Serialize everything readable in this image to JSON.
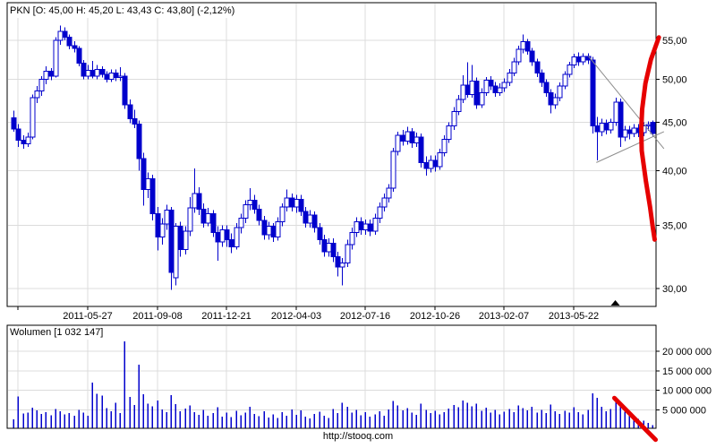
{
  "header": {
    "title": "PKN [O: 45,00 H: 45,20 L: 43,43 C: 43,80] (-2,12%)"
  },
  "footer": {
    "watermark": "http://stooq.com"
  },
  "colors": {
    "candle": "#0000cc",
    "grid": "#dcdcdc",
    "frame": "#000000",
    "trend_line": "#8c8c8c",
    "signal": "#e60000",
    "text": "#000000",
    "background": "#ffffff"
  },
  "chart_data": [
    {
      "panel": "price",
      "type": "candlestick",
      "symbol": "PKN",
      "last_candle": {
        "open": "45,00",
        "high": "45,20",
        "low": "43,43",
        "close": "43,80",
        "change_pct": "-2,12%"
      },
      "scale": "log",
      "grid": true,
      "ylim": [
        28.7,
        60.3
      ],
      "y_ticks": [
        {
          "value": 30,
          "label": "30,00"
        },
        {
          "value": 35,
          "label": "35,00"
        },
        {
          "value": 40,
          "label": "40,00"
        },
        {
          "value": 45,
          "label": "45,00"
        },
        {
          "value": 50,
          "label": "50,00"
        },
        {
          "value": 55,
          "label": "55,00"
        }
      ],
      "x_ticks": [
        {
          "index": 1,
          "label": ""
        },
        {
          "index": 16,
          "label": "2011-05-27"
        },
        {
          "index": 31,
          "label": "2011-09-08"
        },
        {
          "index": 46,
          "label": "2011-12-21"
        },
        {
          "index": 61,
          "label": "2012-04-03"
        },
        {
          "index": 76,
          "label": "2012-07-16"
        },
        {
          "index": 91,
          "label": "2012-10-26"
        },
        {
          "index": 106,
          "label": "2013-02-07"
        },
        {
          "index": 121,
          "label": "2013-05-22"
        }
      ],
      "candles_ohlc": [
        [
          45.5,
          46.3,
          44.0,
          44.3
        ],
        [
          44.3,
          44.8,
          42.4,
          43.1
        ],
        [
          43.1,
          43.6,
          42.2,
          42.7
        ],
        [
          42.7,
          43.9,
          42.4,
          43.4
        ],
        [
          43.4,
          48.2,
          43.2,
          47.8
        ],
        [
          47.8,
          49.2,
          47.2,
          48.6
        ],
        [
          48.6,
          50.4,
          48.0,
          50.0
        ],
        [
          50.0,
          51.6,
          49.4,
          51.0
        ],
        [
          51.0,
          51.4,
          49.9,
          50.4
        ],
        [
          50.4,
          55.4,
          50.2,
          55.0
        ],
        [
          55.0,
          57.0,
          54.4,
          56.2
        ],
        [
          56.2,
          56.8,
          55.0,
          55.4
        ],
        [
          55.4,
          55.8,
          53.8,
          54.3
        ],
        [
          54.3,
          54.9,
          53.4,
          53.9
        ],
        [
          53.9,
          54.2,
          51.6,
          52.0
        ],
        [
          52.0,
          52.4,
          50.0,
          50.4
        ],
        [
          50.4,
          51.8,
          50.0,
          51.1
        ],
        [
          51.1,
          52.3,
          50.1,
          50.4
        ],
        [
          50.4,
          51.8,
          50.0,
          51.2
        ],
        [
          51.2,
          51.6,
          50.2,
          50.6
        ],
        [
          50.6,
          51.0,
          49.6,
          50.0
        ],
        [
          50.0,
          51.2,
          49.7,
          50.8
        ],
        [
          50.8,
          51.2,
          49.8,
          50.2
        ],
        [
          50.2,
          51.5,
          49.8,
          50.4
        ],
        [
          50.4,
          50.8,
          46.5,
          47.0
        ],
        [
          47.0,
          47.6,
          44.9,
          45.4
        ],
        [
          45.4,
          46.4,
          44.4,
          44.8
        ],
        [
          44.8,
          45.2,
          40.0,
          41.2
        ],
        [
          41.2,
          41.8,
          36.7,
          38.2
        ],
        [
          38.2,
          39.8,
          37.4,
          39.2
        ],
        [
          39.2,
          39.6,
          35.4,
          36.0
        ],
        [
          36.0,
          36.6,
          32.9,
          34.0
        ],
        [
          34.0,
          35.6,
          33.4,
          35.1
        ],
        [
          35.1,
          36.8,
          34.6,
          36.3
        ],
        [
          36.3,
          36.6,
          29.9,
          31.2
        ],
        [
          30.8,
          35.2,
          30.2,
          34.9
        ],
        [
          34.9,
          35.3,
          32.4,
          33.0
        ],
        [
          33.0,
          34.9,
          32.6,
          34.5
        ],
        [
          34.5,
          37.5,
          34.1,
          36.5
        ],
        [
          36.5,
          40.2,
          36.1,
          37.8
        ],
        [
          37.8,
          38.4,
          35.9,
          36.4
        ],
        [
          36.4,
          36.9,
          34.8,
          35.2
        ],
        [
          35.2,
          36.5,
          34.9,
          36.0
        ],
        [
          36.0,
          36.3,
          34.0,
          34.4
        ],
        [
          34.4,
          34.9,
          32.1,
          33.6
        ],
        [
          33.6,
          35.0,
          33.2,
          34.6
        ],
        [
          34.6,
          35.0,
          33.2,
          33.8
        ],
        [
          33.8,
          34.3,
          32.7,
          33.2
        ],
        [
          33.2,
          35.2,
          33.0,
          34.8
        ],
        [
          34.8,
          36.0,
          34.3,
          35.6
        ],
        [
          35.6,
          37.2,
          35.2,
          36.8
        ],
        [
          36.8,
          38.3,
          36.3,
          37.2
        ],
        [
          37.2,
          37.7,
          36.0,
          36.4
        ],
        [
          36.4,
          36.8,
          35.0,
          35.4
        ],
        [
          35.4,
          35.8,
          33.8,
          34.2
        ],
        [
          34.2,
          35.3,
          33.8,
          34.9
        ],
        [
          34.9,
          35.2,
          33.6,
          34.0
        ],
        [
          34.0,
          35.7,
          33.7,
          35.3
        ],
        [
          35.3,
          36.9,
          34.9,
          36.6
        ],
        [
          36.6,
          38.2,
          36.2,
          37.4
        ],
        [
          37.4,
          37.8,
          36.2,
          36.6
        ],
        [
          36.6,
          37.7,
          36.1,
          37.3
        ],
        [
          37.3,
          37.7,
          35.8,
          36.2
        ],
        [
          36.2,
          36.6,
          34.8,
          35.2
        ],
        [
          35.2,
          36.3,
          34.8,
          35.9
        ],
        [
          35.9,
          36.2,
          34.4,
          34.8
        ],
        [
          34.8,
          35.2,
          33.4,
          33.8
        ],
        [
          33.8,
          34.2,
          32.4,
          32.8
        ],
        [
          32.8,
          33.9,
          32.4,
          33.5
        ],
        [
          33.5,
          33.9,
          32.0,
          32.4
        ],
        [
          32.4,
          32.8,
          30.9,
          31.6
        ],
        [
          31.6,
          32.3,
          30.2,
          31.9
        ],
        [
          31.9,
          33.8,
          31.6,
          33.4
        ],
        [
          33.4,
          34.8,
          33.0,
          34.4
        ],
        [
          34.4,
          35.7,
          34.0,
          35.3
        ],
        [
          35.3,
          35.7,
          34.2,
          34.6
        ],
        [
          34.6,
          35.5,
          34.2,
          35.1
        ],
        [
          35.1,
          35.5,
          34.1,
          34.5
        ],
        [
          34.5,
          36.0,
          34.2,
          35.6
        ],
        [
          35.6,
          37.0,
          35.2,
          36.6
        ],
        [
          36.6,
          37.8,
          36.2,
          37.4
        ],
        [
          37.4,
          38.7,
          37.0,
          38.3
        ],
        [
          38.3,
          42.3,
          38.0,
          41.9
        ],
        [
          41.9,
          44.0,
          41.5,
          43.6
        ],
        [
          43.6,
          44.2,
          42.5,
          43.0
        ],
        [
          43.0,
          44.5,
          42.6,
          44.0
        ],
        [
          44.0,
          44.4,
          42.3,
          42.8
        ],
        [
          42.8,
          43.9,
          42.4,
          43.4
        ],
        [
          43.4,
          43.8,
          40.3,
          40.8
        ],
        [
          40.8,
          41.4,
          39.5,
          40.2
        ],
        [
          40.2,
          41.5,
          39.8,
          41.0
        ],
        [
          41.0,
          41.5,
          39.9,
          40.4
        ],
        [
          40.4,
          42.2,
          40.1,
          41.8
        ],
        [
          41.8,
          43.6,
          41.4,
          43.2
        ],
        [
          43.2,
          45.0,
          42.8,
          44.6
        ],
        [
          44.6,
          46.7,
          44.2,
          46.2
        ],
        [
          46.2,
          48.1,
          45.8,
          47.6
        ],
        [
          47.6,
          50.5,
          47.2,
          49.3
        ],
        [
          49.3,
          52.1,
          47.8,
          48.2
        ],
        [
          48.2,
          51.8,
          47.8,
          49.8
        ],
        [
          49.8,
          50.2,
          46.5,
          47.0
        ],
        [
          47.0,
          48.9,
          46.6,
          48.4
        ],
        [
          48.4,
          50.3,
          48.0,
          49.9
        ],
        [
          49.9,
          50.4,
          48.7,
          49.2
        ],
        [
          49.2,
          49.7,
          47.9,
          48.4
        ],
        [
          48.4,
          49.5,
          48.0,
          49.0
        ],
        [
          49.0,
          50.1,
          48.5,
          49.6
        ],
        [
          49.6,
          51.3,
          49.2,
          50.8
        ],
        [
          50.8,
          52.7,
          50.4,
          52.2
        ],
        [
          52.2,
          54.3,
          51.8,
          53.8
        ],
        [
          53.8,
          55.8,
          53.3,
          54.8
        ],
        [
          54.8,
          55.2,
          53.1,
          53.6
        ],
        [
          53.6,
          54.0,
          51.7,
          52.2
        ],
        [
          52.2,
          52.6,
          50.3,
          50.8
        ],
        [
          50.8,
          51.2,
          49.1,
          49.6
        ],
        [
          49.6,
          50.0,
          47.9,
          48.4
        ],
        [
          48.4,
          48.8,
          46.0,
          47.0
        ],
        [
          47.0,
          48.3,
          46.5,
          47.8
        ],
        [
          47.8,
          49.6,
          47.4,
          49.2
        ],
        [
          49.2,
          51.0,
          48.8,
          50.6
        ],
        [
          50.6,
          52.2,
          50.2,
          51.8
        ],
        [
          51.8,
          53.2,
          51.4,
          52.8
        ],
        [
          52.8,
          53.4,
          51.7,
          52.2
        ],
        [
          52.2,
          53.3,
          51.8,
          52.9
        ],
        [
          52.9,
          53.3,
          51.9,
          52.4
        ],
        [
          52.4,
          52.8,
          43.8,
          44.6
        ],
        [
          44.6,
          45.6,
          41.0,
          44.0
        ],
        [
          44.0,
          45.4,
          43.5,
          44.9
        ],
        [
          44.9,
          45.3,
          43.7,
          44.2
        ],
        [
          44.2,
          45.4,
          43.8,
          45.0
        ],
        [
          45.0,
          47.8,
          44.6,
          47.3
        ],
        [
          47.3,
          47.7,
          42.4,
          43.4
        ],
        [
          43.4,
          44.6,
          43.0,
          44.2
        ],
        [
          44.2,
          44.6,
          43.2,
          43.8
        ],
        [
          43.8,
          44.8,
          43.4,
          44.4
        ],
        [
          44.4,
          44.8,
          43.4,
          43.9
        ],
        [
          43.9,
          45.0,
          43.5,
          44.6
        ],
        [
          44.6,
          45.1,
          44.1,
          44.75
        ],
        [
          45.0,
          45.2,
          43.43,
          43.8
        ]
      ],
      "overlays": {
        "pennant_lines": [
          {
            "from": [
              124.2,
              52.9
            ],
            "to": [
              140.5,
              42.2
            ]
          },
          {
            "from": [
              125.9,
              40.8
            ],
            "to": [
              140.5,
              44.0
            ]
          }
        ],
        "red_curve": [
          [
            139.4,
            55.4
          ],
          [
            137.7,
            52.5
          ],
          [
            136.5,
            49.5
          ],
          [
            135.8,
            46.5
          ],
          [
            135.6,
            44.3
          ],
          [
            135.7,
            42.0
          ],
          [
            136.6,
            39.0
          ],
          [
            137.5,
            36.6
          ],
          [
            138.1,
            34.8
          ],
          [
            138.5,
            33.8
          ]
        ],
        "marker": {
          "index": 130,
          "glyph": "▲"
        }
      }
    },
    {
      "panel": "volume",
      "type": "bar",
      "title": "Wolumen [1 032 147]",
      "last_value": "1 032 147",
      "grid": true,
      "ylim": [
        0,
        26000000
      ],
      "y_ticks": [
        {
          "value": 5000000,
          "label": "5 000 000"
        },
        {
          "value": 10000000,
          "label": "10 000 000"
        },
        {
          "value": 15000000,
          "label": "15 000 000"
        },
        {
          "value": 20000000,
          "label": "20 000 000"
        }
      ],
      "values": [
        2500000,
        8400000,
        4000000,
        4200000,
        5500000,
        4800000,
        3900000,
        4400000,
        3600000,
        5200000,
        4600000,
        3800000,
        4100000,
        3500000,
        4900000,
        4200000,
        3400000,
        12000000,
        9100000,
        8600000,
        5400000,
        4600000,
        6800000,
        4100000,
        22500000,
        8300000,
        6200000,
        16600000,
        9000000,
        6600000,
        5900000,
        7300000,
        5100000,
        4400000,
        8700000,
        6400000,
        4600000,
        5300000,
        6100000,
        4400000,
        3700000,
        4900000,
        3400000,
        4100000,
        5600000,
        3200000,
        4300000,
        3100000,
        4700000,
        3600000,
        4200000,
        5800000,
        3900000,
        3300000,
        4600000,
        3000000,
        3800000,
        2900000,
        4400000,
        3500000,
        5100000,
        3700000,
        4800000,
        3200000,
        2800000,
        3900000,
        4500000,
        3400000,
        2900000,
        5200000,
        4100000,
        6800000,
        5700000,
        4300000,
        4900000,
        3600000,
        4400000,
        3200000,
        3800000,
        4600000,
        3400000,
        5100000,
        7200000,
        6100000,
        4800000,
        5400000,
        4200000,
        3700000,
        6600000,
        5000000,
        4100000,
        4700000,
        3800000,
        4400000,
        5300000,
        6200000,
        5600000,
        7400000,
        6800000,
        5900000,
        6500000,
        4700000,
        5500000,
        4300000,
        4900000,
        3800000,
        4500000,
        5200000,
        4400000,
        6100000,
        5400000,
        4800000,
        5700000,
        4300000,
        5000000,
        4100000,
        6300000,
        4600000,
        3900000,
        4700000,
        4200000,
        5600000,
        4400000,
        3800000,
        4900000,
        9200000,
        8000000,
        5800000,
        4600000,
        5200000,
        7600000,
        6400000,
        4500000,
        3600000,
        3000000,
        2600000,
        2200000,
        1600000,
        1032147
      ],
      "overlays": {
        "red_line": {
          "from": [
            129.8,
            8000000
          ],
          "to": [
            138.7,
            -2700000
          ]
        }
      }
    }
  ]
}
